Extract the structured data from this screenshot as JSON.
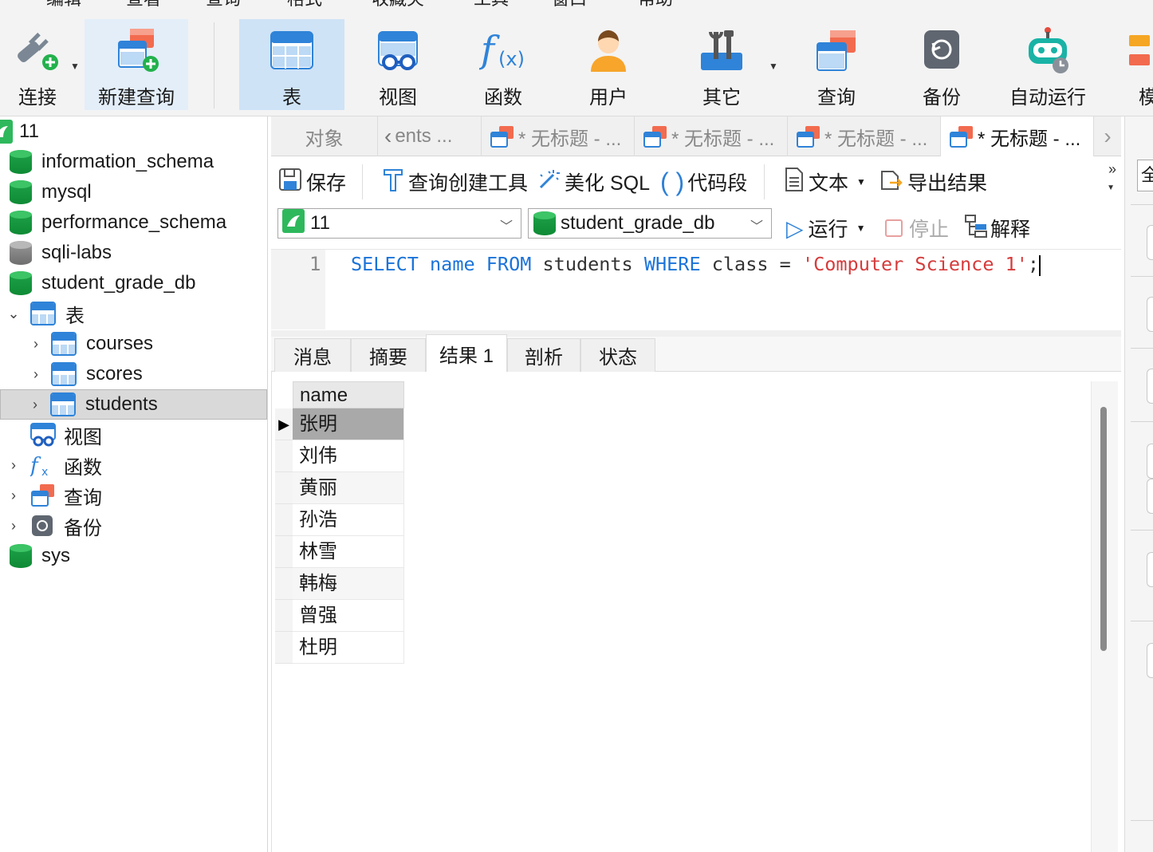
{
  "menubar": {
    "items": [
      "编辑",
      "查看",
      "查询",
      "格式",
      "收藏夹",
      "工具",
      "窗口",
      "帮助"
    ]
  },
  "toolbar": {
    "buttons": [
      {
        "label": "连接",
        "icon": "plug-icon"
      },
      {
        "label": "新建查询",
        "icon": "new-query-icon"
      },
      {
        "label": "表",
        "icon": "table-icon"
      },
      {
        "label": "视图",
        "icon": "view-icon"
      },
      {
        "label": "函数",
        "icon": "function-icon"
      },
      {
        "label": "用户",
        "icon": "user-icon"
      },
      {
        "label": "其它",
        "icon": "tools-icon"
      },
      {
        "label": "查询",
        "icon": "query-icon"
      },
      {
        "label": "备份",
        "icon": "backup-icon"
      },
      {
        "label": "自动运行",
        "icon": "robot-icon"
      },
      {
        "label": "模",
        "icon": "model-icon"
      }
    ]
  },
  "tree": {
    "connection": "11",
    "databases": [
      "information_schema",
      "mysql",
      "performance_schema",
      "sqli-labs",
      "student_grade_db"
    ],
    "tables_group": "表",
    "tables": [
      "courses",
      "scores",
      "students"
    ],
    "views": "视图",
    "functions": "函数",
    "queries": "查询",
    "backups": "备份",
    "sys": "sys"
  },
  "tabs": {
    "objects": "对象",
    "items": [
      "ents ...",
      "* 无标题 - ...",
      "* 无标题 - ...",
      "* 无标题 - ...",
      "* 无标题 - ..."
    ]
  },
  "query_toolbar": {
    "save": "保存",
    "builder": "查询创建工具",
    "beautify": "美化 SQL",
    "snippet": "代码段",
    "text": "文本",
    "export": "导出结果",
    "run": "运行",
    "stop": "停止",
    "explain": "解释"
  },
  "selectors": {
    "connection": "11",
    "database": "student_grade_db"
  },
  "editor": {
    "line_number": "1",
    "tokens": {
      "select": "SELECT",
      "col": " name ",
      "from": "FROM",
      "table": " students ",
      "where": "WHERE",
      "cond": " class = ",
      "literal": "'Computer Science 1'",
      "end": ";"
    }
  },
  "result_tabs": [
    "消息",
    "摘要",
    "结果 1",
    "剖析",
    "状态"
  ],
  "result": {
    "column": "name",
    "rows": [
      "张明",
      "刘伟",
      "黄丽",
      "孙浩",
      "林雪",
      "韩梅",
      "曾强",
      "杜明"
    ],
    "selected_row": 0
  },
  "right_panel": {
    "label": "全"
  },
  "colors": {
    "accent": "#2f83d8",
    "db_green": "#1fa34a",
    "keyword": "#1a73d9",
    "string": "#d63b3b"
  }
}
